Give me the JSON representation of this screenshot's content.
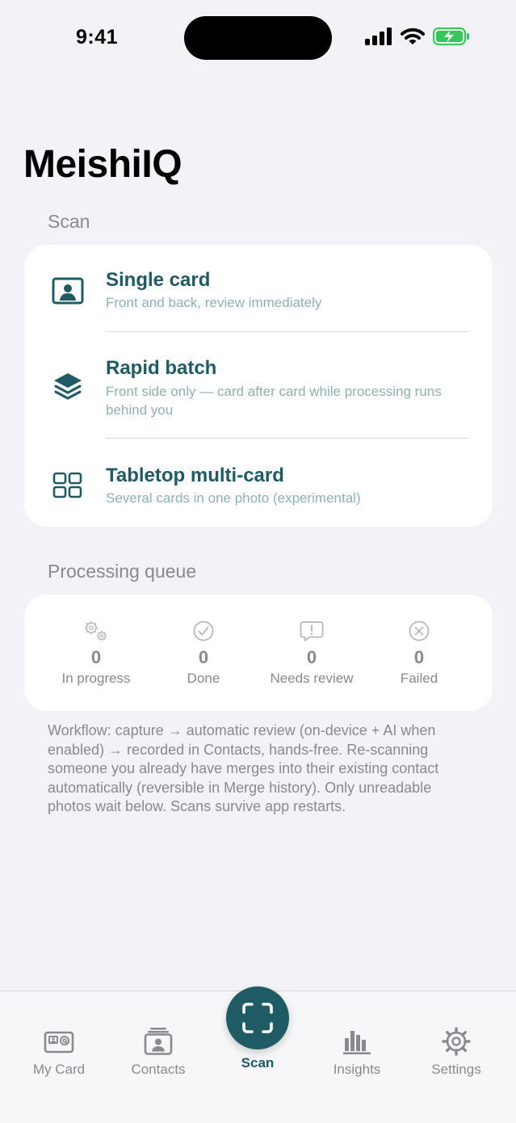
{
  "status_bar": {
    "time": "9:41"
  },
  "app": {
    "title": "MeishiIQ"
  },
  "scan_section": {
    "header": "Scan",
    "options": [
      {
        "icon": "portrait-card-icon",
        "title": "Single card",
        "subtitle": "Front and back, review immediately"
      },
      {
        "icon": "stack-layers-icon",
        "title": "Rapid batch",
        "subtitle": "Front side only — card after card while processing runs behind you"
      },
      {
        "icon": "grid-icon",
        "title": "Tabletop multi-card",
        "subtitle": "Several cards in one photo (experimental)"
      }
    ]
  },
  "queue_section": {
    "header": "Processing queue",
    "stats": [
      {
        "icon": "gears-icon",
        "value": "0",
        "label": "In progress"
      },
      {
        "icon": "checkmark-circle-icon",
        "value": "0",
        "label": "Done"
      },
      {
        "icon": "exclamation-bubble-icon",
        "value": "0",
        "label": "Needs review"
      },
      {
        "icon": "x-circle-icon",
        "value": "0",
        "label": "Failed"
      }
    ]
  },
  "workflow_text": "Workflow: capture → automatic review (on-device + AI when enabled) → recorded in Contacts, hands-free. Re-scanning someone you already have merges into their existing contact automatically (reversible in Merge history). Only unreadable photos wait below. Scans survive app restarts.",
  "tab_bar": {
    "tabs": [
      {
        "icon": "id-card-icon",
        "label": "My Card"
      },
      {
        "icon": "contacts-icon",
        "label": "Contacts"
      },
      {
        "icon": "scan-frame-icon",
        "label": "Scan",
        "active": true
      },
      {
        "icon": "bar-chart-icon",
        "label": "Insights"
      },
      {
        "icon": "gear-icon",
        "label": "Settings"
      }
    ]
  },
  "colors": {
    "accent": "#1f5b65",
    "subtitle": "#8fb0b2",
    "secondary_text": "#8a8a8e",
    "background": "#f2f2f7",
    "battery_green": "#34c759"
  }
}
